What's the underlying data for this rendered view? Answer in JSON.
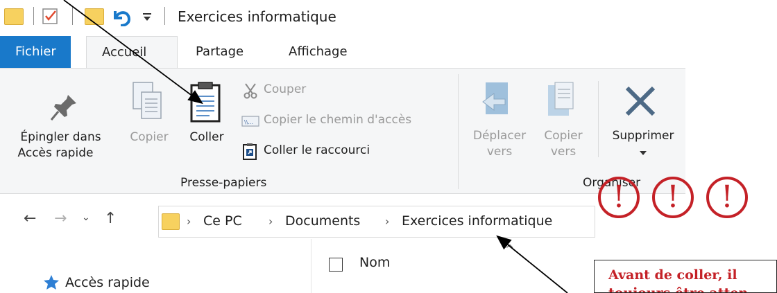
{
  "window": {
    "title": "Exercices informatique"
  },
  "tabs": {
    "file": "Fichier",
    "home": "Accueil",
    "share": "Partage",
    "view": "Affichage"
  },
  "clipboard": {
    "pin_line1": "Épingler dans",
    "pin_line2": "Accès rapide",
    "copy": "Copier",
    "paste": "Coller",
    "cut": "Couper",
    "copy_path": "Copier le chemin d'accès",
    "paste_shortcut": "Coller le raccourci",
    "group_label": "Presse-papiers"
  },
  "organize": {
    "move_line1": "Déplacer",
    "move_line2": "vers",
    "copyto_line1": "Copier",
    "copyto_line2": "vers",
    "delete": "Supprimer",
    "group_label": "Organiser"
  },
  "address": {
    "crumbs": [
      "Ce PC",
      "Documents",
      "Exercices informatique"
    ]
  },
  "content": {
    "column_name": "Nom",
    "quick_access": "Accès rapide"
  },
  "annotations": {
    "warning_mark": "!",
    "callout_line1": "Avant de coller, il",
    "callout_line2": "toujours être atten"
  },
  "colors": {
    "accent": "#1979ca",
    "warning": "#c42127",
    "folder": "#f7d15f"
  }
}
